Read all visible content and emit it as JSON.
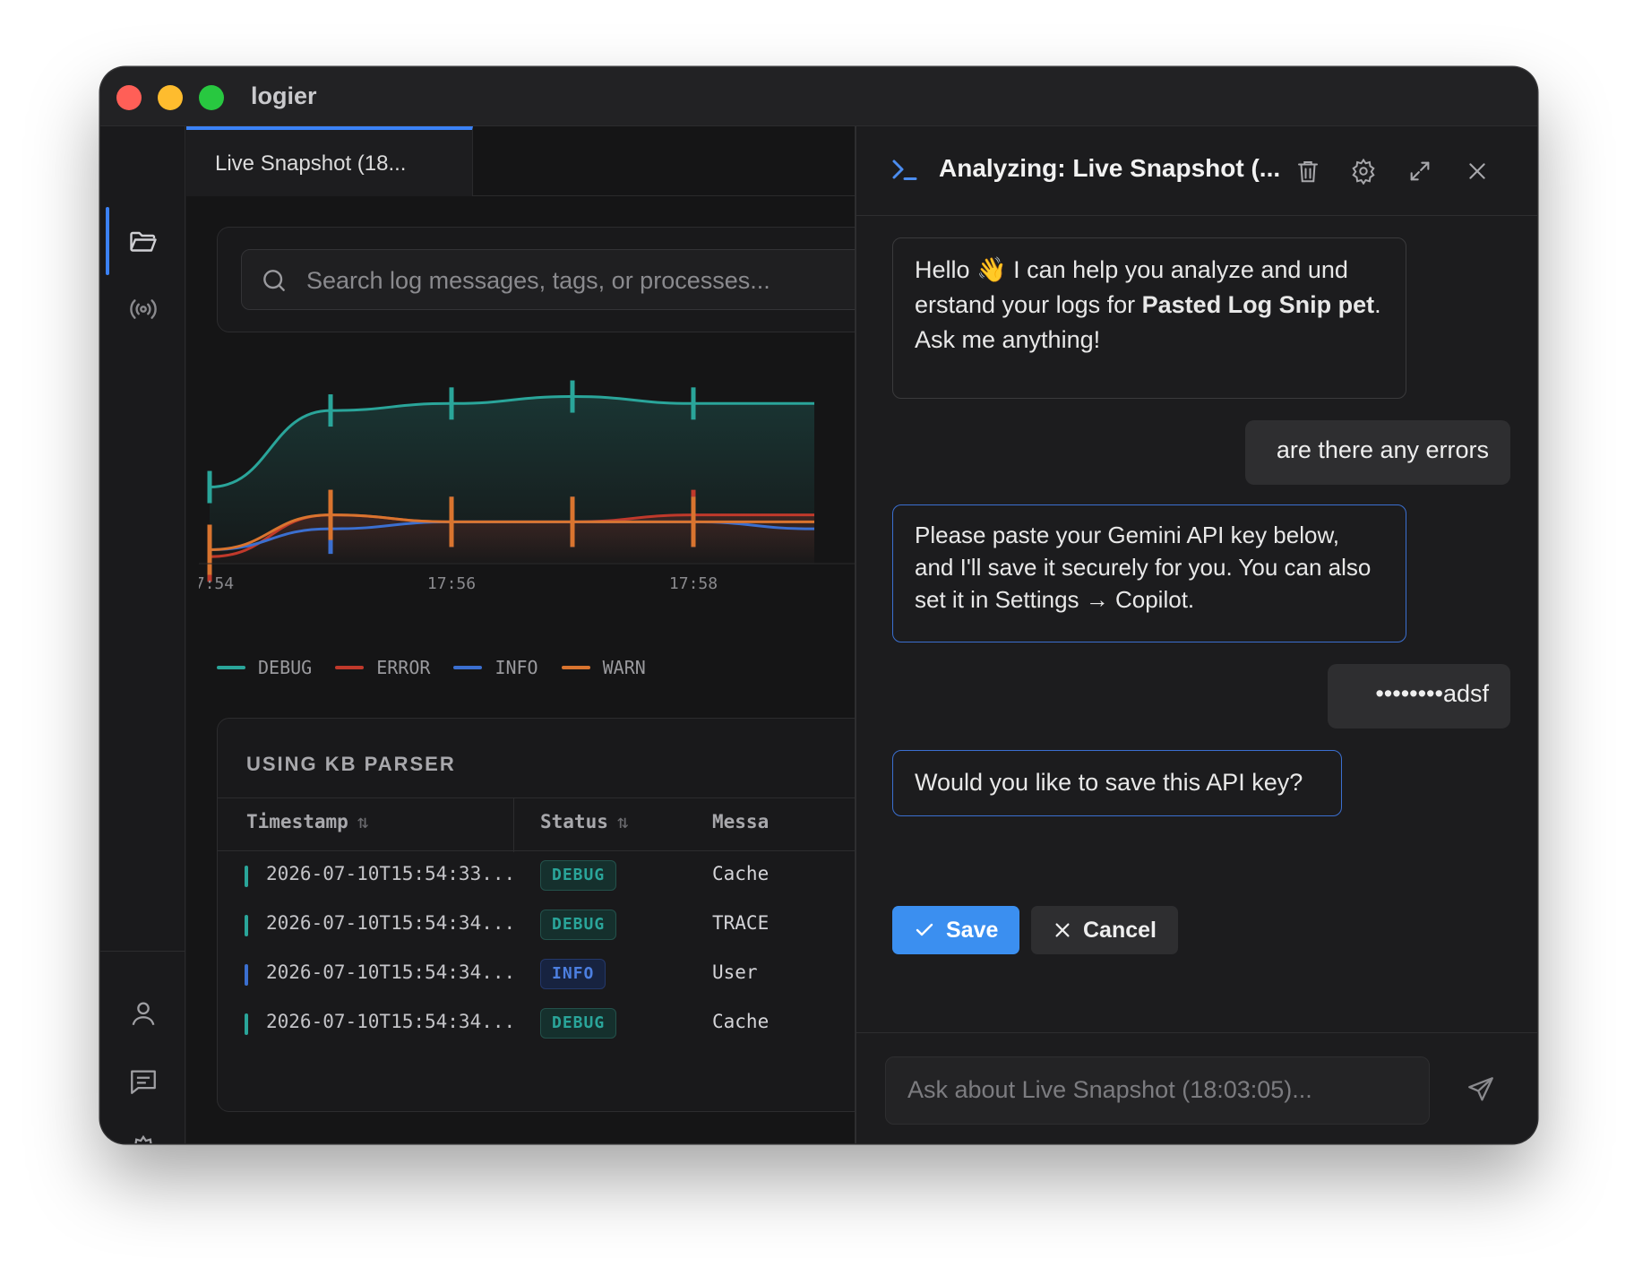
{
  "app": {
    "title": "logier"
  },
  "tab": {
    "label": "Live Snapshot (18..."
  },
  "search": {
    "placeholder": "Search log messages, tags, or processes..."
  },
  "chart_data": {
    "type": "area",
    "x": [
      "17:54",
      "17:55",
      "17:56",
      "17:57",
      "17:58",
      "17:59"
    ],
    "x_ticks": [
      "17:54",
      "17:56",
      "17:58"
    ],
    "series": [
      {
        "name": "DEBUG",
        "color": "#2aa59a",
        "values": [
          11,
          22,
          23,
          24,
          23,
          23
        ]
      },
      {
        "name": "ERROR",
        "color": "#c0392b",
        "values": [
          1,
          7,
          6,
          6,
          7,
          7
        ]
      },
      {
        "name": "INFO",
        "color": "#3b6fd0",
        "values": [
          2,
          5,
          6,
          6,
          6,
          5
        ]
      },
      {
        "name": "WARN",
        "color": "#d9742f",
        "values": [
          2,
          7,
          6,
          6,
          6,
          6
        ]
      }
    ],
    "grid": false,
    "legend": "bottom-left"
  },
  "table": {
    "title": "USING KB PARSER",
    "columns": [
      "Timestamp",
      "Status",
      "Messa"
    ],
    "rows": [
      {
        "timestamp": "2026-07-10T15:54:33...",
        "status": "DEBUG",
        "message": "Cache",
        "color": "#2aa59a"
      },
      {
        "timestamp": "2026-07-10T15:54:34...",
        "status": "DEBUG",
        "message": "TRACE",
        "color": "#2aa59a"
      },
      {
        "timestamp": "2026-07-10T15:54:34...",
        "status": "INFO",
        "message": "User",
        "color": "#3b6fd0"
      },
      {
        "timestamp": "2026-07-10T15:54:34...",
        "status": "DEBUG",
        "message": "Cache",
        "color": "#2aa59a"
      }
    ]
  },
  "panel": {
    "title": "Analyzing: Live Snapshot (...",
    "messages": {
      "greeting_pre": "Hello 👋 I can help you analyze and und erstand your logs for ",
      "greeting_bold": "Pasted Log Snip pet",
      "greeting_post": ". Ask me anything!",
      "user_question": "are there any errors",
      "api_prompt": "Please paste your Gemini API key below, and I'll save it securely for you. You can also set it in Settings → Copilot.",
      "user_key": "••••••••adsf",
      "confirm": "Would you like to save this API key?"
    },
    "save_label": "Save",
    "cancel_label": "Cancel",
    "input_placeholder": "Ask about Live Snapshot (18:03:05)..."
  },
  "sidebar": {
    "items": [
      "folder-icon",
      "broadcast-icon",
      "user-icon",
      "messages-icon",
      "settings-icon"
    ]
  },
  "colors": {
    "accent": "#3b82f6",
    "save": "#3b8ff0"
  }
}
